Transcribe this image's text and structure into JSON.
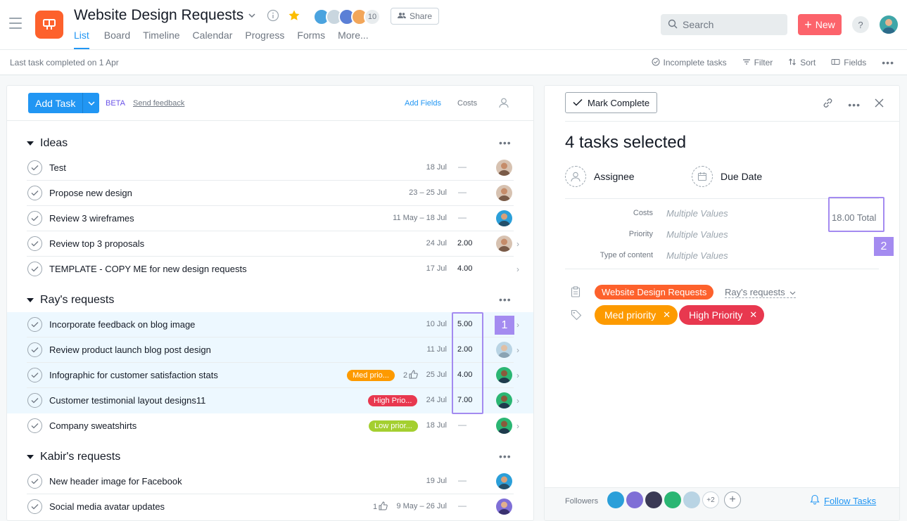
{
  "app": {
    "title": "Website Design Requests"
  },
  "tabs": [
    {
      "label": "List"
    },
    {
      "label": "Board"
    },
    {
      "label": "Timeline"
    },
    {
      "label": "Calendar"
    },
    {
      "label": "Progress"
    },
    {
      "label": "Forms"
    },
    {
      "label": "More..."
    }
  ],
  "members": {
    "count": "10"
  },
  "toolbar": {
    "share_label": "Share",
    "search_placeholder": "Search",
    "new_label": "New",
    "help_label": "?"
  },
  "subbar": {
    "last_completed": "Last task completed on 1 Apr",
    "incomplete": "Incomplete tasks",
    "filter": "Filter",
    "sort": "Sort",
    "fields": "Fields"
  },
  "list": {
    "add_task": "Add Task",
    "beta": "BETA",
    "feedback": "Send feedback",
    "add_fields": "Add Fields",
    "costs_header": "Costs",
    "sections": [
      {
        "name": "Ideas",
        "tasks": [
          {
            "name": "Test",
            "date": "18 Jul",
            "cost": "—",
            "selected": false
          },
          {
            "name": "Propose new design",
            "date": "23 – 25 Jul",
            "cost": "—",
            "selected": false
          },
          {
            "name": "Review 3 wireframes",
            "date": "11 May – 18 Jul",
            "cost": "—",
            "selected": false
          },
          {
            "name": "Review top 3 proposals",
            "date": "24 Jul",
            "cost": "2.00",
            "selected": false
          },
          {
            "name": "TEMPLATE - COPY ME for new design requests",
            "date": "17 Jul",
            "cost": "4.00",
            "selected": false
          }
        ]
      },
      {
        "name": "Ray's requests",
        "tasks": [
          {
            "name": "Incorporate feedback on blog image",
            "date": "10 Jul",
            "cost": "5.00",
            "selected": true
          },
          {
            "name": "Review product launch blog post design",
            "date": "11 Jul",
            "cost": "2.00",
            "selected": true
          },
          {
            "name": "Infographic for customer satisfaction stats",
            "date": "25 Jul",
            "cost": "4.00",
            "selected": true,
            "tag": "Med prio...",
            "likes": "2"
          },
          {
            "name": "Customer testimonial layout designs11",
            "date": "24 Jul",
            "cost": "7.00",
            "selected": true,
            "tag": "High Prio..."
          },
          {
            "name": "Company sweatshirts",
            "date": "18 Jul",
            "cost": "—",
            "selected": false,
            "tag": "Low prior..."
          }
        ]
      },
      {
        "name": "Kabir's requests",
        "tasks": [
          {
            "name": "New header image for Facebook",
            "date": "19 Jul",
            "cost": "—",
            "selected": false
          },
          {
            "name": "Social media avatar updates",
            "date": "9 May – 26 Jul",
            "cost": "—",
            "selected": false,
            "likes": "1"
          }
        ]
      }
    ]
  },
  "annotations": {
    "one": "1",
    "two": "2"
  },
  "detail": {
    "mark_complete": "Mark Complete",
    "title": "4 tasks selected",
    "assignee": "Assignee",
    "due_date": "Due Date",
    "fields": [
      {
        "label": "Costs",
        "value": "Multiple Values"
      },
      {
        "label": "Priority",
        "value": "Multiple Values"
      },
      {
        "label": "Type of content",
        "value": "Multiple Values"
      }
    ],
    "costs_total": "18.00 Total",
    "project_pill": "Website Design Requests",
    "section_select": "Ray's requests",
    "tags": [
      {
        "label": "Med priority"
      },
      {
        "label": "High Priority"
      }
    ],
    "followers_label": "Followers",
    "followers_more": "+2",
    "follow_tasks": "Follow Tasks"
  },
  "colors": {
    "accent": "#2196f3",
    "brand": "#fd612c",
    "new_button": "#fc636b",
    "med": "#fd9a00",
    "high": "#e8384f",
    "low": "#a4cf30",
    "annotation": "#a48bf0",
    "selected_bg": "#edf8ff"
  }
}
